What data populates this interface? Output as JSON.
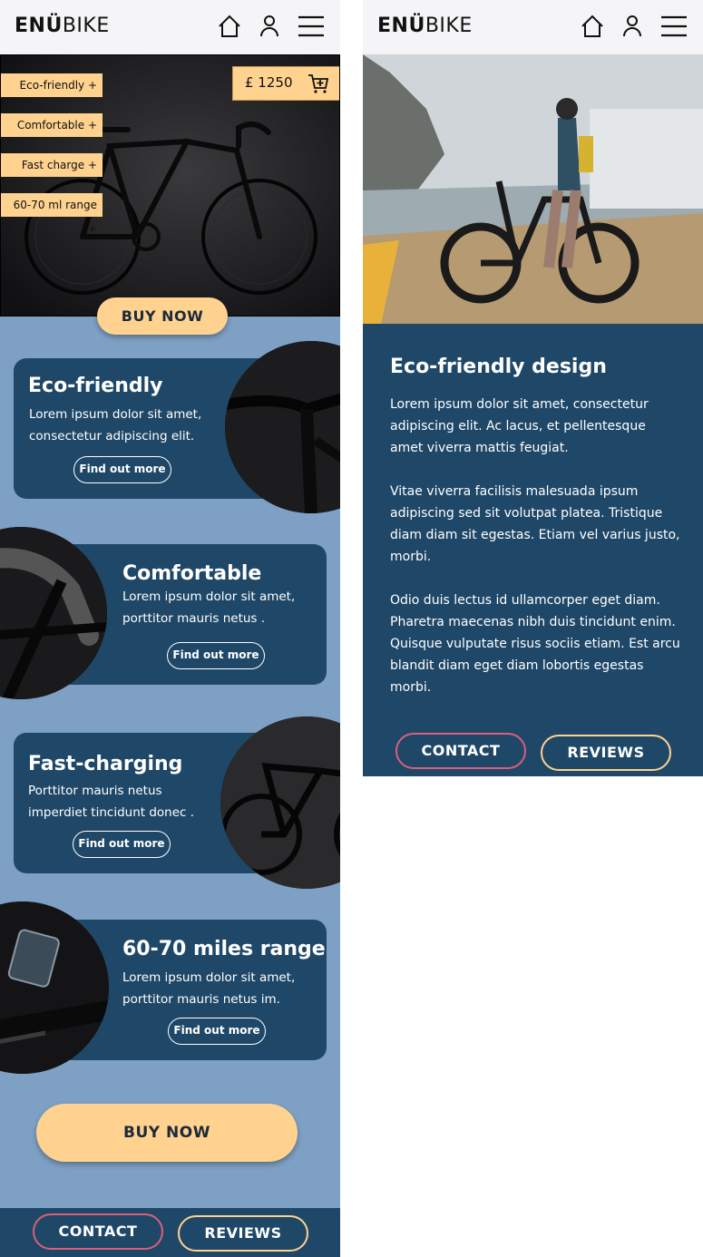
{
  "brand": {
    "bold": "ENÜ",
    "light": "BIKE"
  },
  "header_icons": [
    "home-icon",
    "user-icon",
    "menu-icon"
  ],
  "hero": {
    "tags": [
      "Eco-friendly +",
      "Comfortable +",
      "Fast charge +",
      "60-70 ml range +"
    ],
    "price": "£ 1250",
    "buy_label": "BUY NOW"
  },
  "features": [
    {
      "title": "Eco-friendly",
      "text": "Lorem ipsum dolor sit amet, consectetur adipiscing elit.",
      "button": "Find out more"
    },
    {
      "title": "Comfortable",
      "text": "Lorem ipsum dolor sit amet, porttitor mauris netus .",
      "button": "Find out more"
    },
    {
      "title": "Fast-charging",
      "text": "Porttitor mauris netus imperdiet tincidunt donec .",
      "button": "Find out more"
    },
    {
      "title": "60-70 miles range",
      "text": "Lorem ipsum dolor sit amet, porttitor mauris netus im.",
      "button": "Find out more"
    }
  ],
  "bottom_buy_label": "BUY NOW",
  "footer": {
    "contact": "CONTACT",
    "reviews": "REVIEWS"
  },
  "detail": {
    "title": "Eco-friendly design",
    "paragraphs": [
      "Lorem ipsum dolor sit amet, consectetur adipiscing elit. Ac lacus, et pellentesque amet viverra mattis feugiat.",
      "Vitae viverra facilisis malesuada ipsum adipiscing sed sit volutpat platea. Tristique diam diam sit egestas. Etiam vel varius justo, morbi.",
      "Odio duis lectus id ullamcorper eget diam. Pharetra maecenas nibh duis tincidunt enim. Quisque vulputate risus sociis etiam. Est arcu blandit diam eget diam lobortis egestas morbi."
    ],
    "contact": "CONTACT",
    "reviews": "REVIEWS"
  },
  "colors": {
    "navy": "#1f4868",
    "peach": "#ffd28f",
    "sky": "#7ea0c4",
    "pink": "#d9607a"
  }
}
